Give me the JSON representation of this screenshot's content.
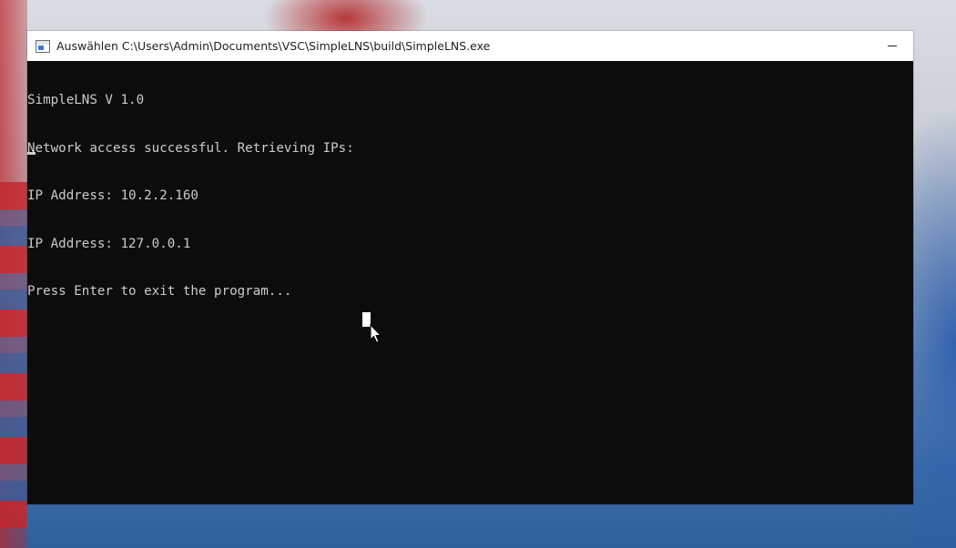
{
  "window": {
    "title": "Auswählen C:\\Users\\Admin\\Documents\\VSC\\SimpleLNS\\build\\SimpleLNS.exe",
    "icon": "console-app-icon",
    "minimize_icon": "minimize-icon"
  },
  "console": {
    "lines": [
      "SimpleLNS V 1.0",
      "Network access successful. Retrieving IPs:",
      "IP Address: 10.2.2.160",
      "IP Address: 127.0.0.1",
      "Press Enter to exit the program..."
    ],
    "background": "#0c0c0c",
    "foreground": "#cccccc"
  },
  "pointer": {
    "icon": "mouse-pointer-icon"
  }
}
